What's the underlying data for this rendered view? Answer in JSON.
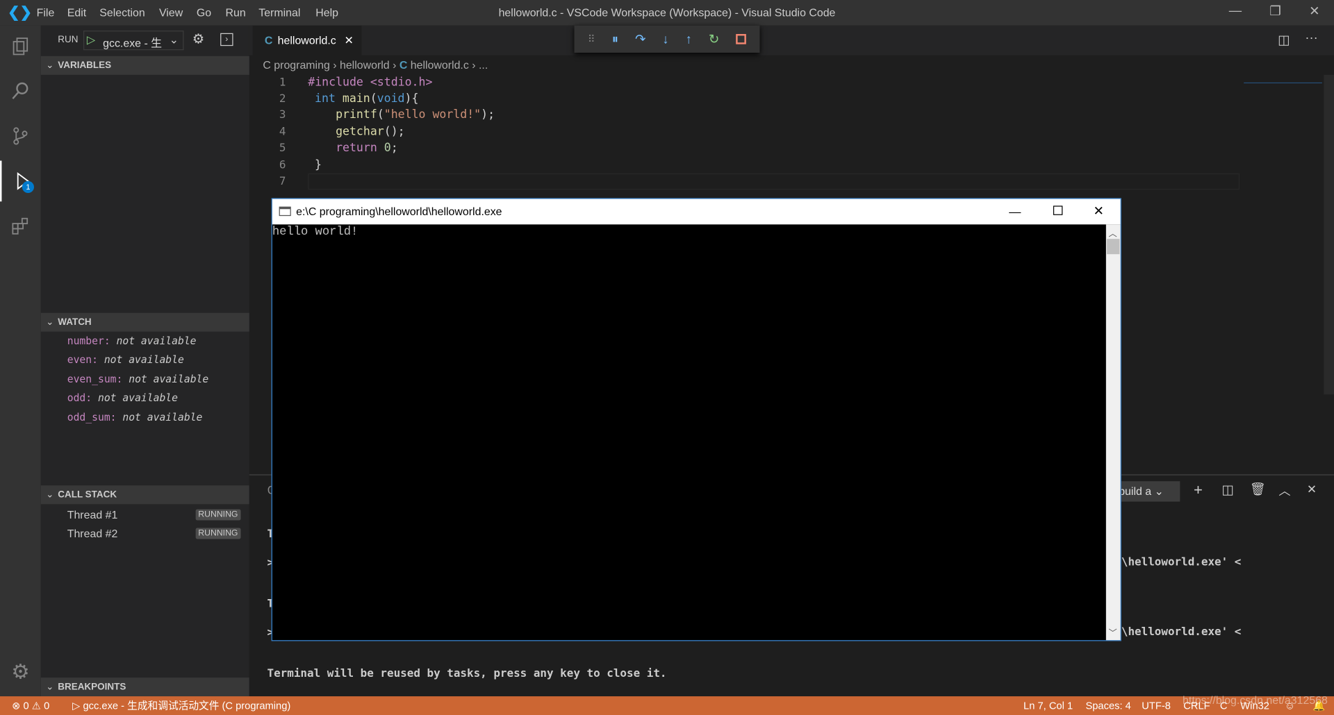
{
  "window": {
    "title": "helloworld.c - VSCode Workspace (Workspace) - Visual Studio Code"
  },
  "menu": [
    "File",
    "Edit",
    "Selection",
    "View",
    "Go",
    "Run",
    "Terminal",
    "Help"
  ],
  "run": {
    "label": "RUN",
    "config": "gcc.exe - 生"
  },
  "sidebar": {
    "variables": "VARIABLES",
    "watch": {
      "title": "WATCH",
      "items": [
        {
          "name": "number:",
          "value": "not available"
        },
        {
          "name": "even:",
          "value": "not available"
        },
        {
          "name": "even_sum:",
          "value": "not available"
        },
        {
          "name": "odd:",
          "value": "not available"
        },
        {
          "name": "odd_sum:",
          "value": "not available"
        }
      ]
    },
    "callstack": {
      "title": "CALL STACK",
      "threads": [
        {
          "name": "Thread #1",
          "state": "RUNNING"
        },
        {
          "name": "Thread #2",
          "state": "RUNNING"
        }
      ]
    },
    "breakpoints": "BREAKPOINTS"
  },
  "activity_badge": "1",
  "tab": {
    "label": "helloworld.c",
    "lang": "C"
  },
  "breadcrumb": [
    "C programing",
    "helloworld",
    "helloworld.c",
    "..."
  ],
  "code": [
    "#include <stdio.h>",
    "int main(void){",
    "    printf(\"hello world!\");",
    "    getchar();",
    "    return 0;",
    "}",
    ""
  ],
  "console": {
    "title": "e:\\C programing\\helloworld\\helloworld.exe",
    "output": "hello world!"
  },
  "panel": {
    "dropdown": "build a",
    "lines": [
      "\\helloworld.exe' <",
      "\\helloworld.exe' <"
    ],
    "message": "Terminal will be reused by tasks, press any key to close it."
  },
  "status": {
    "errors": "0",
    "warnings": "0",
    "launch": "gcc.exe - 生成和调试活动文件 (C programing)",
    "position": "Ln 7, Col 1",
    "spaces": "Spaces: 4",
    "encoding": "UTF-8",
    "eol": "CRLF",
    "language": "C",
    "platform": "Win32",
    "watermark": "https://blog.csdn.net/a312568"
  },
  "colors": {
    "statusbar": "#cc6633",
    "accent": "#007acc"
  }
}
